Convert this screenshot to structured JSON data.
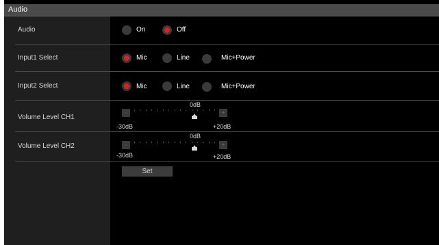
{
  "header": {
    "title": "Audio"
  },
  "rows": {
    "audio": {
      "label": "Audio",
      "options": [
        "On",
        "Off"
      ],
      "selected": "Off"
    },
    "input1": {
      "label": "Input1 Select",
      "options": [
        "Mic",
        "Line",
        "Mic+Power"
      ],
      "selected": "Mic"
    },
    "input2": {
      "label": "Input2 Select",
      "options": [
        "Mic",
        "Line",
        "Mic+Power"
      ],
      "selected": "Mic"
    },
    "vol1": {
      "label": "Volume Level CH1",
      "min": "-30dB",
      "max": "+20dB",
      "center": "0dB",
      "minus": "-",
      "plus": "+",
      "value_db": 0
    },
    "vol2": {
      "label": "Volume Level CH2",
      "min": "-30dB",
      "max": "+20dB",
      "center": "0dB",
      "minus": "-",
      "plus": "+",
      "value_db": 0
    }
  },
  "actions": {
    "set_label": "Set"
  },
  "colors": {
    "accent": "#e02020",
    "title_bar": "#4a4a4a",
    "label_column": "#1f1f1f",
    "background": "#000000"
  }
}
